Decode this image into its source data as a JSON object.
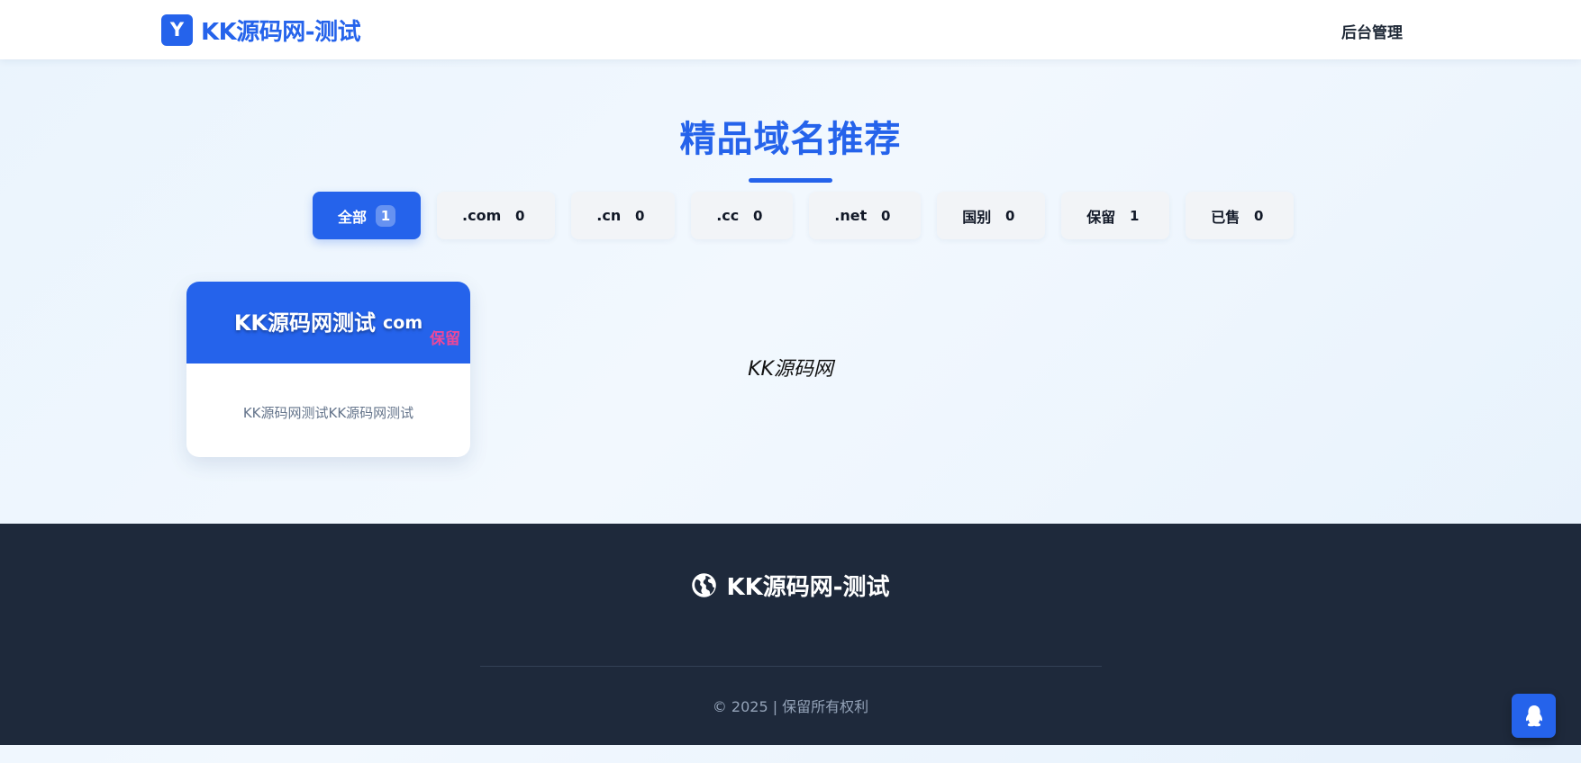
{
  "header": {
    "logo_badge": "Y",
    "logo_text": "KK源码网-测试",
    "admin_link": "后台管理"
  },
  "main": {
    "section_title": "精品域名推荐",
    "filters": [
      {
        "label": "全部",
        "count": "1",
        "active": true
      },
      {
        "label": ".com",
        "count": "0",
        "active": false
      },
      {
        "label": ".cn",
        "count": "0",
        "active": false
      },
      {
        "label": ".cc",
        "count": "0",
        "active": false
      },
      {
        "label": ".net",
        "count": "0",
        "active": false
      },
      {
        "label": "国别",
        "count": "0",
        "active": false
      },
      {
        "label": "保留",
        "count": "1",
        "active": false
      },
      {
        "label": "已售",
        "count": "0",
        "active": false
      }
    ],
    "cards": [
      {
        "name": "KK源码网测试",
        "suffix": "com",
        "status": "保留",
        "description": "KK源码网测试KK源码网测试"
      }
    ],
    "watermark": "KK源码网"
  },
  "footer": {
    "brand": "KK源码网-测试",
    "copyright": "© 2025 | 保留所有权利"
  },
  "colors": {
    "primary": "#2563eb",
    "status_reserved": "#ec4899",
    "footer_bg": "#1e293b"
  },
  "icons": {
    "footer_brand": "globe-icon",
    "float_button": "qq-penguin-icon"
  }
}
